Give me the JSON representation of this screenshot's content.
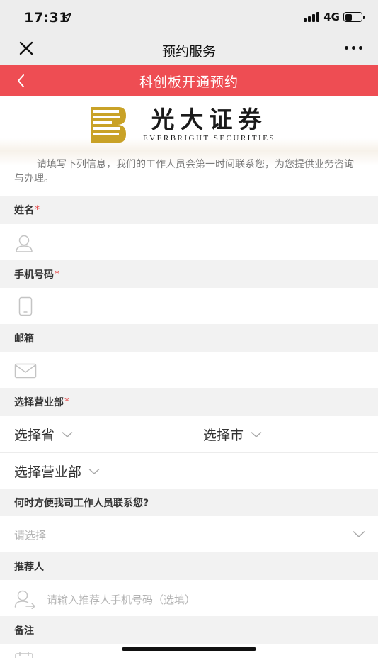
{
  "status_bar": {
    "time": "17:31",
    "network": "4G",
    "battery_level": 0.45
  },
  "wechat_bar": {
    "title": "预约服务",
    "close_icon": "close-icon",
    "more_icon": "more-dots-icon"
  },
  "header": {
    "title": "科创板开通预约",
    "back_icon": "chevron-left-icon",
    "color": "#ee4d53"
  },
  "brand": {
    "name_cn": "光大证券",
    "name_en": "EVERBRIGHT SECURITIES",
    "logo_color": "#c9a227"
  },
  "intro": "请填写下列信息，我们的工作人员会第一时间联系您，为您提供业务咨询与办理。",
  "form": {
    "name": {
      "label": "姓名",
      "required_mark": "*",
      "icon": "user-icon"
    },
    "phone": {
      "label": "手机号码",
      "required_mark": "*",
      "icon": "phone-icon"
    },
    "email": {
      "label": "邮箱",
      "icon": "mail-icon"
    },
    "branch": {
      "label": "选择营业部",
      "required_mark": "*",
      "province": "选择省",
      "city": "选择市",
      "office": "选择营业部"
    },
    "contact_time": {
      "label": "何时方便我司工作人员联系您?",
      "placeholder": "请选择"
    },
    "referrer": {
      "label": "推荐人",
      "placeholder": "请输入推荐人手机号码（选填）",
      "icon": "user-add-icon"
    },
    "note": {
      "label": "备注",
      "icon": "note-icon"
    }
  }
}
